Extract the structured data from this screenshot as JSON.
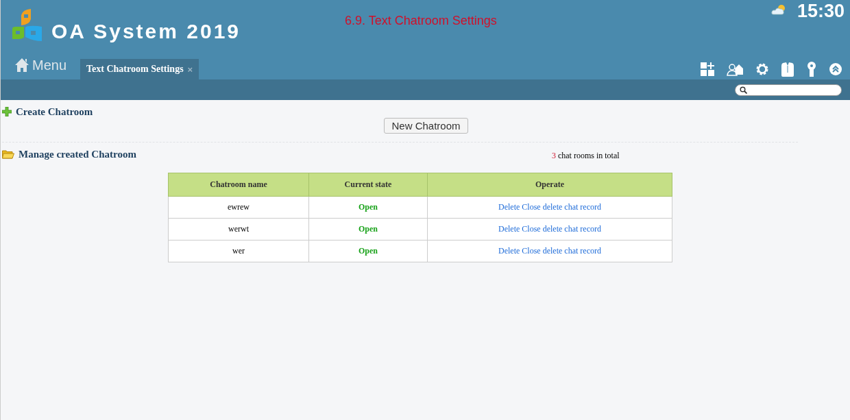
{
  "app_title": "OA System 2019",
  "caption": "6.9. Text Chatroom Settings",
  "clock": "15:30",
  "menu_label": "Menu",
  "tabs": [
    {
      "label": "Text Chatroom Settings",
      "selected": true,
      "close": "×"
    }
  ],
  "create_section": {
    "title": "Create Chatroom",
    "button": "New Chatroom"
  },
  "manage_section": {
    "title": "Manage created Chatroom",
    "count": "3",
    "count_label": "chat rooms in total"
  },
  "table": {
    "columns": [
      "Chatroom name",
      "Current state",
      "Operate"
    ],
    "rows": [
      {
        "name": "ewrew",
        "state": "Open",
        "actions": [
          "Delete",
          "Close",
          "delete chat record"
        ]
      },
      {
        "name": "werwt",
        "state": "Open",
        "actions": [
          "Delete",
          "Close",
          "delete chat record"
        ]
      },
      {
        "name": "wer",
        "state": "Open",
        "actions": [
          "Delete",
          "Close",
          "delete chat record"
        ]
      }
    ]
  }
}
